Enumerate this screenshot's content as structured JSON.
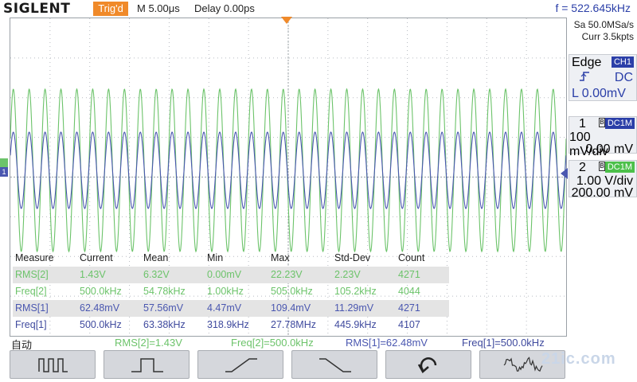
{
  "header": {
    "brand": "SIGLENT",
    "trig_status": "Trig'd",
    "timebase": "M 5.00μs",
    "delay": "Delay 0.00ps",
    "frequency": "f = 522.645kHz"
  },
  "acquisition": {
    "sample_rate": "Sa 50.0MSa/s",
    "memory_depth": "Curr 3.5kpts"
  },
  "trigger": {
    "type": "Edge",
    "source": "CH1",
    "coupling": "DC",
    "slope_icon": "rising-edge-icon",
    "level": "L  0.00mV"
  },
  "channels": [
    {
      "num": "1",
      "coupling": "DC1M",
      "scale": "100 mV/div",
      "offset": "0.00 mV",
      "color": "#4a57b0"
    },
    {
      "num": "2",
      "coupling": "DC1M",
      "scale": "1.00 V/div",
      "offset": "200.00 mV",
      "color": "#6cc36a"
    }
  ],
  "measure": {
    "headers": [
      "Measure",
      "Current",
      "Mean",
      "Min",
      "Max",
      "Std-Dev",
      "Count"
    ],
    "rows": [
      {
        "name": "RMS[2]",
        "current": "1.43V",
        "mean": "6.32V",
        "min": "0.00mV",
        "max": "22.23V",
        "std": "2.23V",
        "count": "4271"
      },
      {
        "name": "Freq[2]",
        "current": "500.0kHz",
        "mean": "54.78kHz",
        "min": "1.00kHz",
        "max": "505.0kHz",
        "std": "105.2kHz",
        "count": "4044"
      },
      {
        "name": "RMS[1]",
        "current": "62.48mV",
        "mean": "57.56mV",
        "min": "4.47mV",
        "max": "109.4mV",
        "std": "11.29mV",
        "count": "4271"
      },
      {
        "name": "Freq[1]",
        "current": "500.0kHz",
        "mean": "63.38kHz",
        "min": "318.9kHz",
        "max": "27.78MHz",
        "std": "445.9kHz",
        "count": "4107"
      }
    ]
  },
  "status": {
    "mode": "自动",
    "m1": "RMS[2]=1.43V",
    "m2": "Freq[2]=500.0kHz",
    "m3": "RMS[1]=62.48mV",
    "m4": "Freq[1]=500.0kHz"
  },
  "softkeys": [
    {
      "icon": "square-wave-icon"
    },
    {
      "icon": "pulse-icon"
    },
    {
      "icon": "ramp-up-icon"
    },
    {
      "icon": "ramp-down-icon"
    },
    {
      "icon": "return-arrow-icon"
    },
    {
      "icon": "noise-wave-icon"
    }
  ],
  "colors": {
    "ch1": "#4a57b0",
    "ch2": "#6cc36a",
    "trigger": "#f08a2a",
    "accent": "#2b3fa8"
  }
}
